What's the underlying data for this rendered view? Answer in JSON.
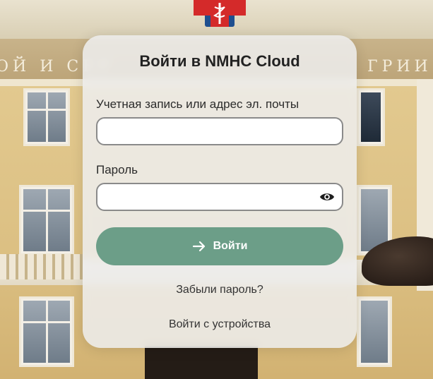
{
  "login": {
    "title": "Войти в NMHC Cloud",
    "username_label": "Учетная запись или адрес эл. почты",
    "username_value": "",
    "password_label": "Пароль",
    "password_value": "",
    "submit_label": "Войти",
    "forgot_password": "Забыли пароль?",
    "device_login": "Войти с устройства"
  },
  "background": {
    "frieze_left": "ОЙ И СЕР",
    "frieze_right": "ГРИИ"
  },
  "icons": {
    "submit": "arrow-right-icon",
    "password_toggle": "eye-icon",
    "logo": "medical-cross-logo"
  },
  "colors": {
    "accent": "#6c9e88",
    "card": "#eeeeee",
    "logo_red": "#d42a2a"
  }
}
